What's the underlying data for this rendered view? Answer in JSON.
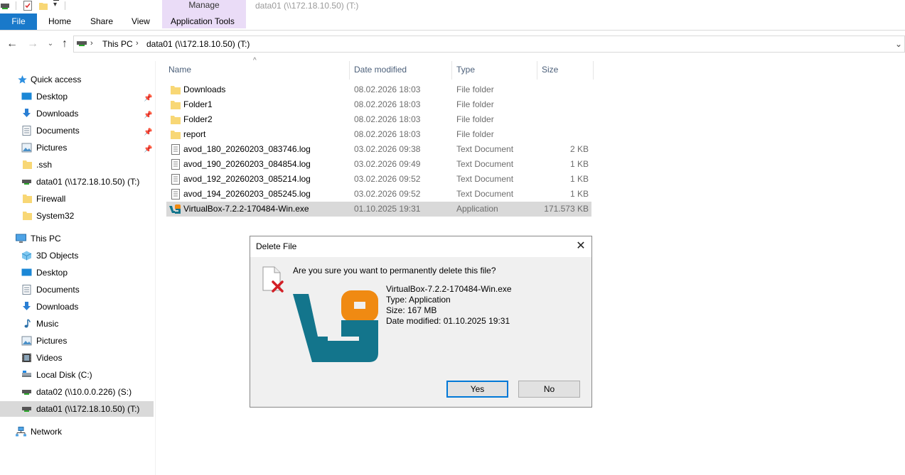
{
  "window": {
    "title": "data01 (\\\\172.18.10.50) (T:)",
    "contextual_group": "Manage",
    "ribbon_tabs": [
      "File",
      "Home",
      "Share",
      "View",
      "Application Tools"
    ]
  },
  "address": {
    "crumbs": [
      "This PC",
      "data01 (\\\\172.18.10.50) (T:)"
    ]
  },
  "navpane": {
    "quick_access": {
      "label": "Quick access",
      "items": [
        {
          "label": "Desktop",
          "icon": "desktop-icon",
          "pinned": true
        },
        {
          "label": "Downloads",
          "icon": "downloads-icon",
          "pinned": true
        },
        {
          "label": "Documents",
          "icon": "documents-icon",
          "pinned": true
        },
        {
          "label": "Pictures",
          "icon": "pictures-icon",
          "pinned": true
        },
        {
          "label": ".ssh",
          "icon": "folder-icon",
          "pinned": false
        },
        {
          "label": "data01 (\\\\172.18.10.50) (T:)",
          "icon": "network-drive-icon",
          "pinned": false
        },
        {
          "label": "Firewall",
          "icon": "folder-icon",
          "pinned": false
        },
        {
          "label": "System32",
          "icon": "folder-icon",
          "pinned": false
        }
      ]
    },
    "this_pc": {
      "label": "This PC",
      "items": [
        {
          "label": "3D Objects",
          "icon": "3d-objects-icon"
        },
        {
          "label": "Desktop",
          "icon": "desktop-icon"
        },
        {
          "label": "Documents",
          "icon": "documents-icon"
        },
        {
          "label": "Downloads",
          "icon": "downloads-icon"
        },
        {
          "label": "Music",
          "icon": "music-icon"
        },
        {
          "label": "Pictures",
          "icon": "pictures-icon"
        },
        {
          "label": "Videos",
          "icon": "videos-icon"
        },
        {
          "label": "Local Disk (C:)",
          "icon": "local-disk-icon"
        },
        {
          "label": "data02 (\\\\10.0.0.226) (S:)",
          "icon": "network-drive-icon"
        },
        {
          "label": "data01 (\\\\172.18.10.50) (T:)",
          "icon": "network-drive-icon",
          "selected": true
        }
      ]
    },
    "network": {
      "label": "Network"
    }
  },
  "filelist": {
    "columns": {
      "name": "Name",
      "date": "Date modified",
      "type": "Type",
      "size": "Size"
    },
    "rows": [
      {
        "name": "Downloads",
        "date": "08.02.2026 18:03",
        "type": "File folder",
        "size": "",
        "icon": "folder-icon"
      },
      {
        "name": "Folder1",
        "date": "08.02.2026 18:03",
        "type": "File folder",
        "size": "",
        "icon": "folder-icon"
      },
      {
        "name": "Folder2",
        "date": "08.02.2026 18:03",
        "type": "File folder",
        "size": "",
        "icon": "folder-icon"
      },
      {
        "name": "report",
        "date": "08.02.2026 18:03",
        "type": "File folder",
        "size": "",
        "icon": "folder-icon"
      },
      {
        "name": "avod_180_20260203_083746.log",
        "date": "03.02.2026 09:38",
        "type": "Text Document",
        "size": "2 KB",
        "icon": "text-file-icon"
      },
      {
        "name": "avod_190_20260203_084854.log",
        "date": "03.02.2026 09:49",
        "type": "Text Document",
        "size": "1 KB",
        "icon": "text-file-icon"
      },
      {
        "name": "avod_192_20260203_085214.log",
        "date": "03.02.2026 09:52",
        "type": "Text Document",
        "size": "1 KB",
        "icon": "text-file-icon"
      },
      {
        "name": "avod_194_20260203_085245.log",
        "date": "03.02.2026 09:52",
        "type": "Text Document",
        "size": "1 KB",
        "icon": "text-file-icon"
      },
      {
        "name": "VirtualBox-7.2.2-170484-Win.exe",
        "date": "01.10.2025 19:31",
        "type": "Application",
        "size": "171.573 KB",
        "icon": "virtualbox-icon",
        "selected": true
      }
    ]
  },
  "dialog": {
    "title": "Delete File",
    "question": "Are you sure you want to permanently delete this file?",
    "details": [
      "VirtualBox-7.2.2-170484-Win.exe",
      "Type: Application",
      "Size: 167 MB",
      "Date modified: 01.10.2025 19:31"
    ],
    "yes_label": "Yes",
    "no_label": "No"
  },
  "colors": {
    "file_tab": "#1979ca",
    "manage_tab": "#eadcf7",
    "selection": "#d9d9d9",
    "vbox_teal": "#13758c",
    "vbox_orange": "#f08a12",
    "delete_red": "#d31f26"
  }
}
